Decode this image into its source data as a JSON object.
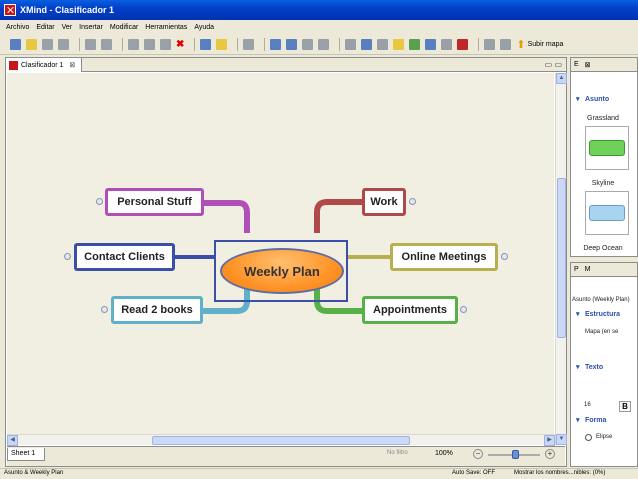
{
  "window": {
    "title": "XMind - Clasificador 1"
  },
  "menu": [
    "Archivo",
    "Editar",
    "Ver",
    "Insertar",
    "Modificar",
    "Herramientas",
    "Ayuda"
  ],
  "toolbar": {
    "subir_label": "Subir mapa"
  },
  "editor": {
    "tab_label": "Clasificador 1",
    "sheet_label": "Sheet 1",
    "filter_text": "No filtro",
    "zoom": "100%"
  },
  "mindmap": {
    "central": "Weekly Plan",
    "topics": [
      {
        "label": "Personal Stuff",
        "color": "#b04fb8"
      },
      {
        "label": "Contact Clients",
        "color": "#3c4fa8"
      },
      {
        "label": "Read 2 books",
        "color": "#5fb0c8"
      },
      {
        "label": "Work",
        "color": "#b04a4a"
      },
      {
        "label": "Online Meetings",
        "color": "#b8b050"
      },
      {
        "label": "Appointments",
        "color": "#58b048"
      }
    ]
  },
  "right_panel_top": {
    "tabs": [
      "E",
      "⊠"
    ],
    "section": "Asunto",
    "styles": [
      {
        "label": "Grassland",
        "color": "#6fd05a"
      },
      {
        "label": "Skyline",
        "color": "#a8d4f0"
      },
      {
        "label": "Deep Ocean"
      }
    ]
  },
  "right_panel_bottom": {
    "tabs": [
      "P",
      "M"
    ],
    "header": "Asunto (Weekly Plan)",
    "sections": [
      "Estructura",
      "Texto",
      "Forma"
    ],
    "estructura_value": "Mapa (en se",
    "font_size": "16",
    "bold_label": "B",
    "forma_value": "Elipse"
  },
  "status": {
    "left": "Asunto & Weekly Plan",
    "autosave": "Auto Save: OFF",
    "names": "Mostrar los nombres...nibles: (0%)"
  }
}
